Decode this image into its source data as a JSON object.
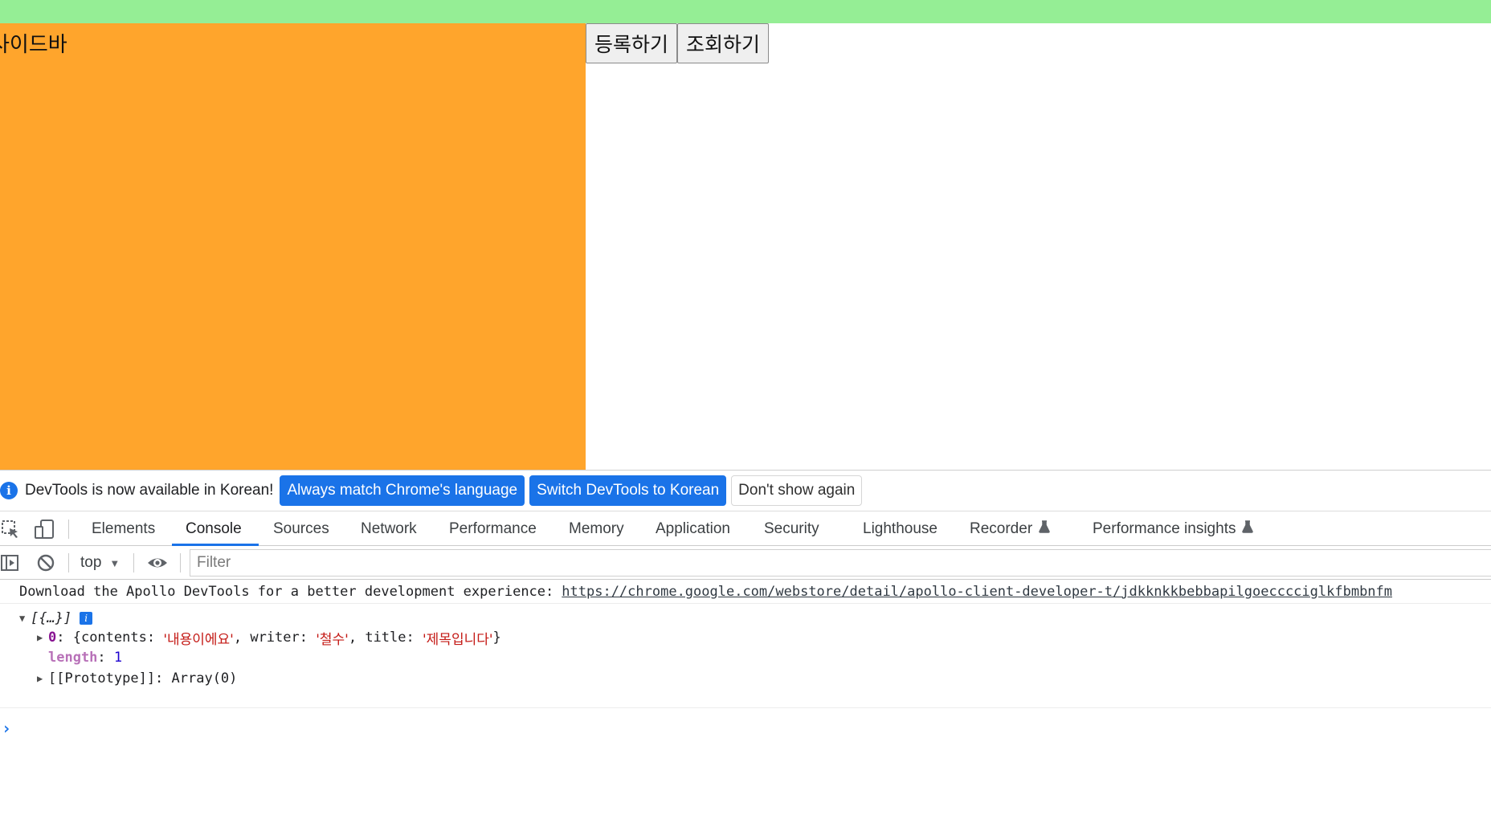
{
  "page": {
    "sidebar_label": "사이드바",
    "buttons": {
      "register": "등록하기",
      "view": "조회하기"
    }
  },
  "devtools": {
    "infobar": {
      "text": "DevTools is now available in Korean!",
      "btn_match": "Always match Chrome's language",
      "btn_switch": "Switch DevTools to Korean",
      "btn_dismiss": "Don't show again"
    },
    "tabs": [
      "Elements",
      "Console",
      "Sources",
      "Network",
      "Performance",
      "Memory",
      "Application",
      "Security",
      "Lighthouse",
      "Recorder",
      "Performance insights"
    ],
    "active_tab": "Console",
    "toolbar": {
      "context": "top",
      "filter_placeholder": "Filter"
    },
    "console": {
      "message_text": "Download the Apollo DevTools for a better development experience:",
      "message_link": "https://chrome.google.com/webstore/detail/apollo-client-developer-t/jdkknkkbebbapilgoecccciglkfbmbnfm",
      "array_summary": "[{…}]",
      "info_badge": "i",
      "item0_index": "0",
      "item0_open": ": {contents: ",
      "item0_contents": "'내용이에요'",
      "item0_writer_key": ", writer: ",
      "item0_writer": "'철수'",
      "item0_title_key": ", title: ",
      "item0_title": "'제목입니다'",
      "item0_close": "}",
      "length_key": "length",
      "length_sep": ": ",
      "length_value": "1",
      "prototype_line": "[[Prototype]]: Array(0)",
      "prompt": "›"
    }
  }
}
